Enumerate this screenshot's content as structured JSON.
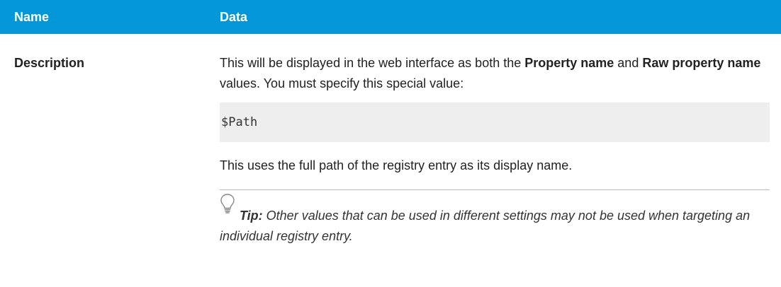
{
  "table": {
    "header": {
      "name_label": "Name",
      "data_label": "Data"
    },
    "row": {
      "name": "Description",
      "para1_prefix": "This will be displayed in the web interface as both the ",
      "para1_bold1": "Property name",
      "para1_mid": " and ",
      "para1_bold2": "Raw property name",
      "para1_suffix": " values. You must specify this special value:",
      "code": "$Path",
      "para2": "This uses the full path of the registry entry as its display name.",
      "tip_label": "Tip:",
      "tip_text": " Other values that can be used in different settings may not be used when targeting an individual registry entry."
    }
  },
  "colors": {
    "header_bg": "#0497d8",
    "code_bg": "#eeeeee"
  },
  "icons": {
    "tip": "lightbulb-icon"
  }
}
